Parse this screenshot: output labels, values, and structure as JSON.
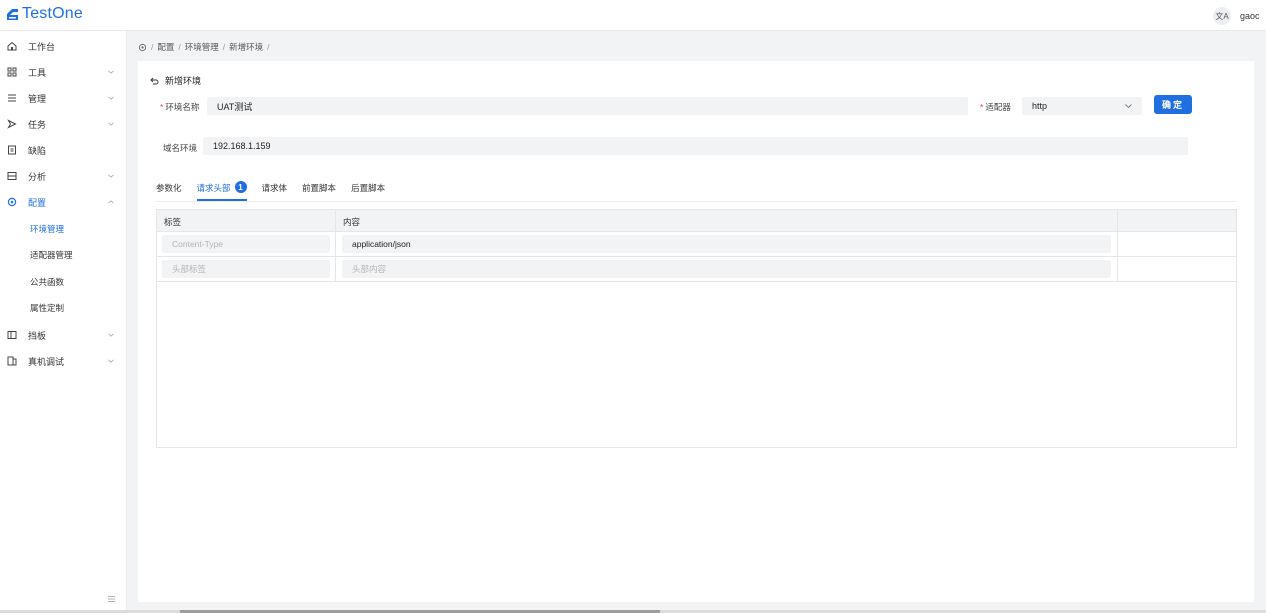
{
  "app": {
    "logo_text": "TestOne",
    "username": "gaoc",
    "translate_glyph": "文A"
  },
  "sidebar": {
    "items": [
      {
        "label": "工作台",
        "icon": "home-icon"
      },
      {
        "label": "工具",
        "icon": "grid-icon"
      },
      {
        "label": "管理",
        "icon": "list-icon"
      },
      {
        "label": "任务",
        "icon": "play-icon"
      },
      {
        "label": "缺陷",
        "icon": "bug-file-icon"
      },
      {
        "label": "分析",
        "icon": "chart-icon"
      },
      {
        "label": "配置",
        "icon": "settings-icon"
      },
      {
        "label": "挡板",
        "icon": "panel-icon"
      },
      {
        "label": "真机调试",
        "icon": "device-icon"
      }
    ],
    "sub_items": [
      {
        "label": "环境管理"
      },
      {
        "label": "适配器管理"
      },
      {
        "label": "公共函数"
      },
      {
        "label": "属性定制"
      }
    ]
  },
  "breadcrumb": {
    "items": [
      "配置",
      "环境管理",
      "新增环境"
    ],
    "sep": "/"
  },
  "page": {
    "back_label": "新增环境"
  },
  "form": {
    "env_name_label": "环境名称",
    "env_name_value": "UAT测试",
    "adapter_label": "适配器",
    "adapter_value": "http",
    "confirm_label": "确定",
    "domain_label": "域名环境",
    "domain_value": "192.168.1.159"
  },
  "tabs": [
    {
      "label": "参数化"
    },
    {
      "label": "请求头部",
      "badge": "1"
    },
    {
      "label": "请求体"
    },
    {
      "label": "前置脚本"
    },
    {
      "label": "后置脚本"
    }
  ],
  "table": {
    "headers": [
      "标签",
      "内容"
    ],
    "rows": [
      {
        "label_placeholder": "Content-Type",
        "content_value": "application/json"
      },
      {
        "label_placeholder": "头部标签",
        "content_placeholder": "头部内容"
      }
    ]
  },
  "colors": {
    "accent": "#1f6fe0",
    "required": "#e54545",
    "input_bg": "#f2f3f5"
  }
}
